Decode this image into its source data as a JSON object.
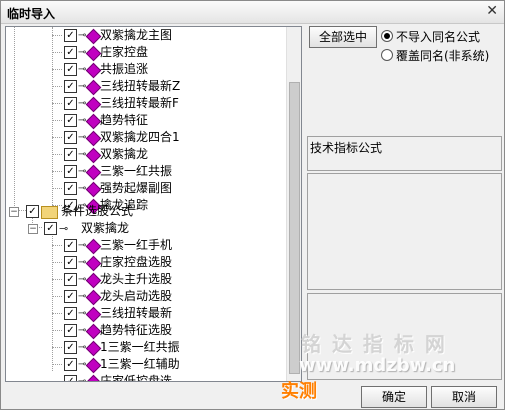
{
  "window": {
    "title": "临时导入",
    "close_glyph": "✕"
  },
  "tree": {
    "items": [
      {
        "label": "双紫擒龙主图"
      },
      {
        "label": "庄家控盘"
      },
      {
        "label": "共振追涨"
      },
      {
        "label": "三线扭转最新Z"
      },
      {
        "label": "三线扭转最新F"
      },
      {
        "label": "趋势特征"
      },
      {
        "label": "双紫擒龙四合1"
      },
      {
        "label": "双紫擒龙"
      },
      {
        "label": "三紫一红共振"
      },
      {
        "label": "强势起爆副图"
      },
      {
        "label": "擒龙追踪"
      },
      {
        "label": "条件选股公式"
      },
      {
        "label": "双紫擒龙"
      },
      {
        "label": "三紫一红手机"
      },
      {
        "label": "庄家控盘选股"
      },
      {
        "label": "龙头主升选股"
      },
      {
        "label": "龙头启动选股"
      },
      {
        "label": "三线扭转最新"
      },
      {
        "label": "趋势特征选股"
      },
      {
        "label": "1三紫一红共振"
      },
      {
        "label": "1三紫一红辅助"
      },
      {
        "label": "庄家低控盘选"
      }
    ]
  },
  "controls": {
    "select_all": "全部选中",
    "radio1": "不导入同名公式",
    "radio2": "覆盖同名(非系统)",
    "formula_label": "技术指标公式",
    "ok": "确定",
    "cancel": "取消"
  },
  "watermark": {
    "line1": "铭 达 指 标 网",
    "line2": "www.mdzbw.cn",
    "line3": "实测"
  }
}
